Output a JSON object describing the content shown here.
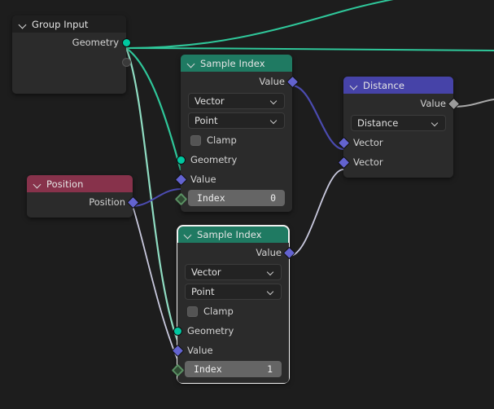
{
  "app": {
    "editor": "blender-geometry-node-editor",
    "canvas_bg": "#1d1d1d"
  },
  "colors": {
    "header_geometry": "#1f7a62",
    "header_input_geometry": "#1f1f1f",
    "header_vector": "#4643a8",
    "header_input_attribute": "#87324b",
    "node_body": "#2b2b2b",
    "socket_geometry": "#00c7a0",
    "socket_vector": "#6363d0",
    "socket_vector_highlight": "#b9bae8",
    "socket_integer": "#5a9063",
    "socket_gray": "#9a9a9a",
    "wire_geometry": "#2fc79a",
    "wire_vector": "#4b4bb0",
    "wire_highlight": "#c9c9de",
    "wire_gray": "#a8a8a8",
    "selection_outline": "#f0f0f0"
  },
  "nodes": {
    "group_input": {
      "title": "Group Input",
      "outputs": [
        {
          "label": "Geometry",
          "type": "geometry",
          "connected": true
        },
        {
          "label": "",
          "type": "geometry",
          "connected": false
        }
      ]
    },
    "position": {
      "title": "Position",
      "outputs": [
        {
          "label": "Position",
          "type": "vector"
        }
      ]
    },
    "sample_index_1": {
      "title": "Sample Index",
      "selected": false,
      "outputs": [
        {
          "label": "Value",
          "type": "vector"
        }
      ],
      "dropdowns": [
        {
          "name": "data-type",
          "value": "Vector"
        },
        {
          "name": "domain",
          "value": "Point"
        }
      ],
      "checkbox": {
        "label": "Clamp",
        "checked": false
      },
      "inputs": [
        {
          "label": "Geometry",
          "type": "geometry"
        },
        {
          "label": "Value",
          "type": "vector"
        }
      ],
      "index_field": {
        "label": "Index",
        "value": "0"
      }
    },
    "sample_index_2": {
      "title": "Sample Index",
      "selected": true,
      "outputs": [
        {
          "label": "Value",
          "type": "vector"
        }
      ],
      "dropdowns": [
        {
          "name": "data-type",
          "value": "Vector"
        },
        {
          "name": "domain",
          "value": "Point"
        }
      ],
      "checkbox": {
        "label": "Clamp",
        "checked": false
      },
      "inputs": [
        {
          "label": "Geometry",
          "type": "geometry"
        },
        {
          "label": "Value",
          "type": "vector"
        }
      ],
      "index_field": {
        "label": "Index",
        "value": "1"
      }
    },
    "distance": {
      "title": "Distance",
      "outputs": [
        {
          "label": "Value",
          "type": "gray"
        }
      ],
      "dropdowns": [
        {
          "name": "operation",
          "value": "Distance"
        }
      ],
      "inputs": [
        {
          "label": "Vector",
          "type": "vector"
        },
        {
          "label": "Vector",
          "type": "vector"
        }
      ]
    }
  }
}
